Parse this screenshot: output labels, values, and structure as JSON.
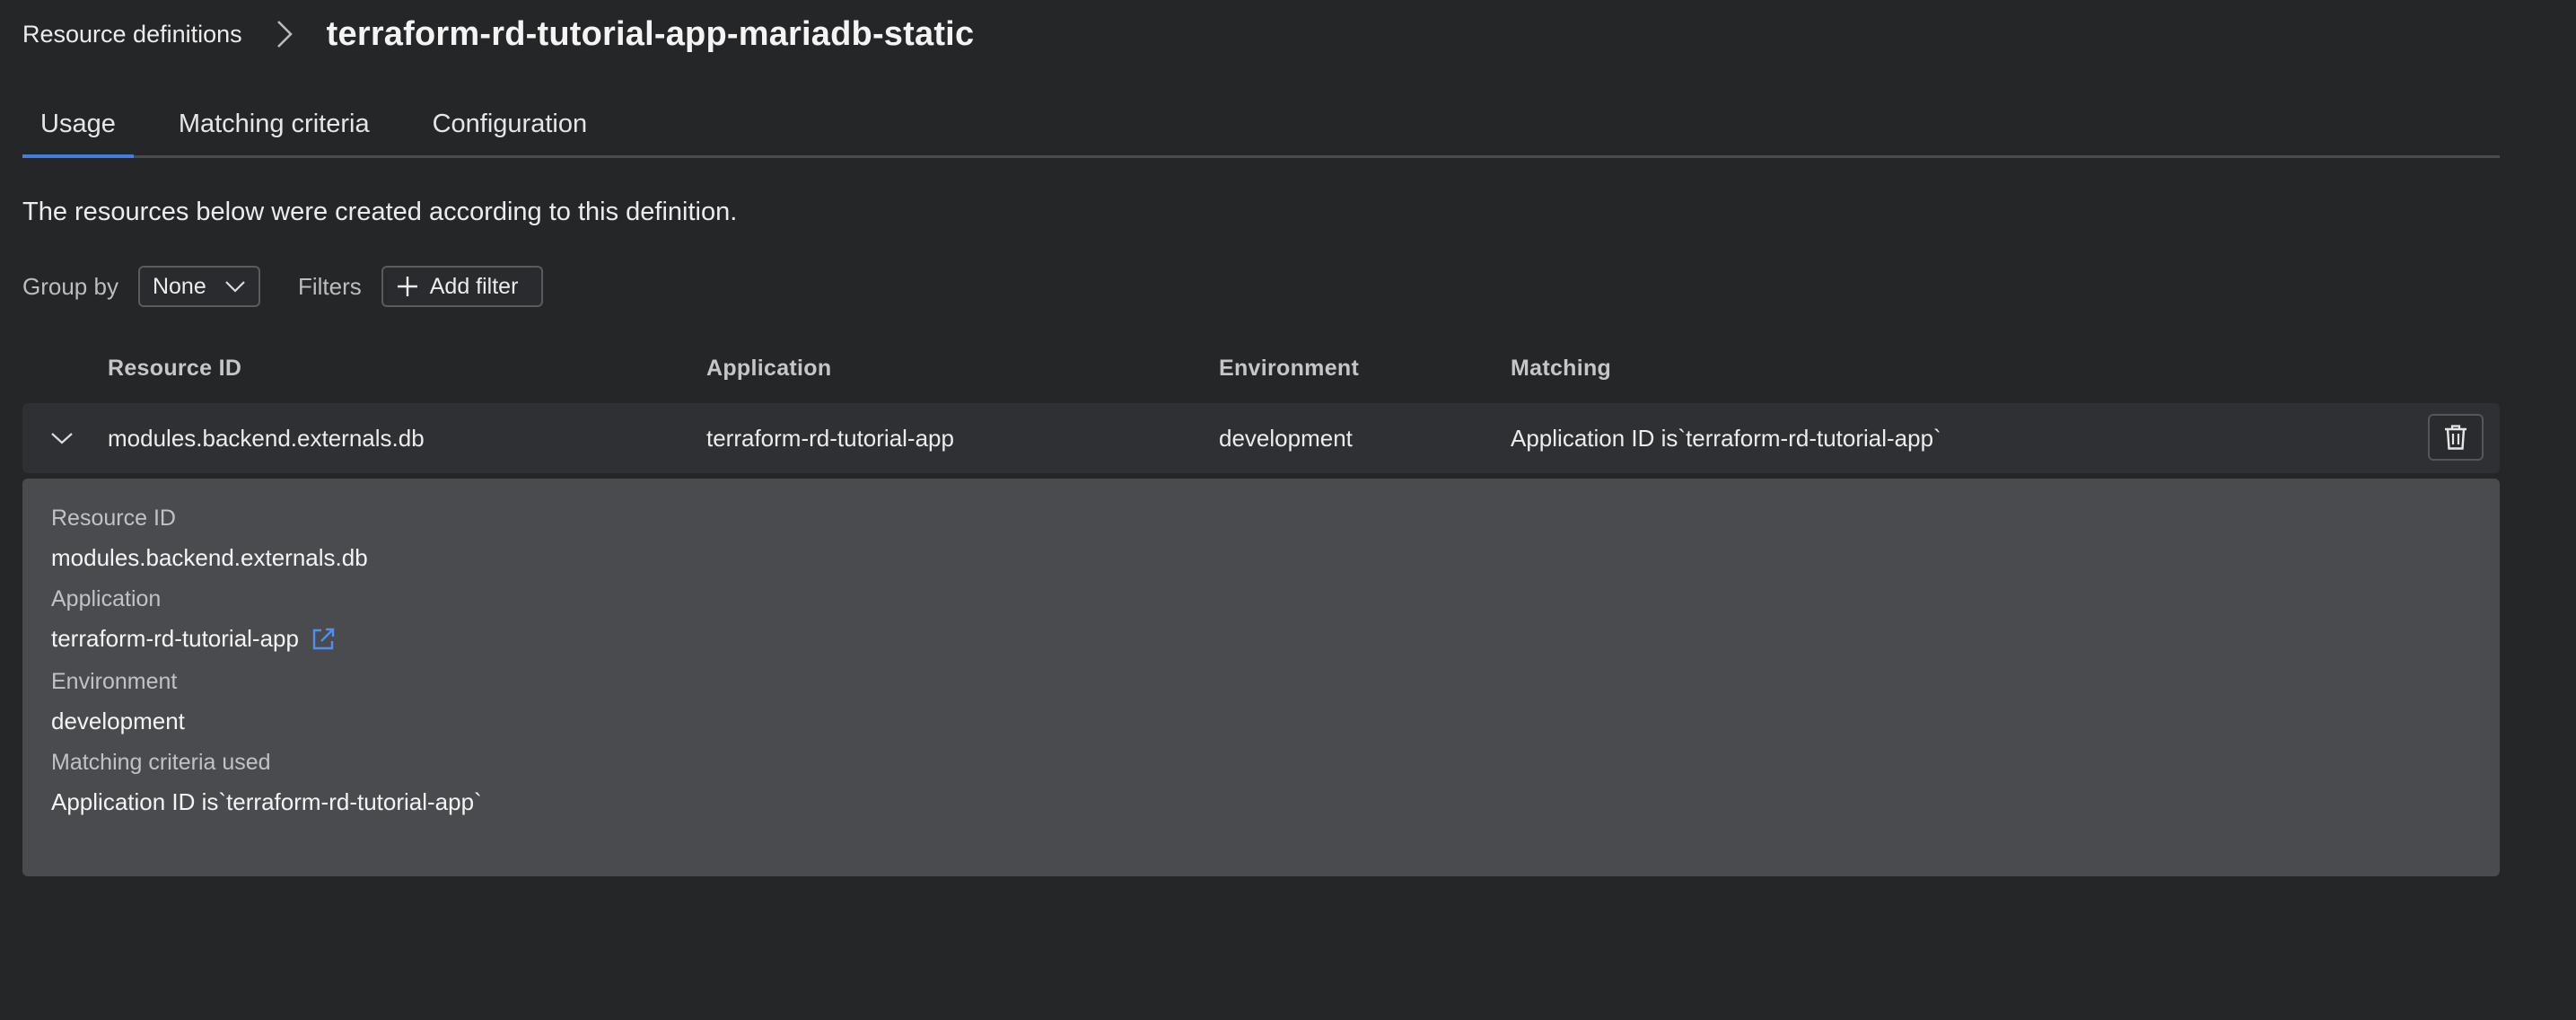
{
  "breadcrumb": {
    "parent": "Resource definitions",
    "current": "terraform-rd-tutorial-app-mariadb-static"
  },
  "tabs": [
    {
      "label": "Usage",
      "active": true
    },
    {
      "label": "Matching criteria",
      "active": false
    },
    {
      "label": "Configuration",
      "active": false
    }
  ],
  "description": "The resources below were created according to this definition.",
  "toolbar": {
    "group_by_label": "Group by",
    "group_by_value": "None",
    "filters_label": "Filters",
    "add_filter_label": "Add filter"
  },
  "table": {
    "columns": [
      "Resource ID",
      "Application",
      "Environment",
      "Matching"
    ],
    "rows": [
      {
        "resource_id": "modules.backend.externals.db",
        "application": "terraform-rd-tutorial-app",
        "environment": "development",
        "matching": "Application ID is`terraform-rd-tutorial-app`"
      }
    ]
  },
  "detail": {
    "resource_id_label": "Resource ID",
    "resource_id_value": "modules.backend.externals.db",
    "application_label": "Application",
    "application_value": "terraform-rd-tutorial-app",
    "environment_label": "Environment",
    "environment_value": "development",
    "matching_label": "Matching criteria used",
    "matching_value": "Application ID is`terraform-rd-tutorial-app`"
  },
  "colors": {
    "background": "#252628",
    "accent": "#3f7fe0",
    "row_background": "#2f3033",
    "detail_background": "#4a4b4f"
  },
  "icons": {
    "breadcrumb_separator": "chevron-right-icon",
    "select_caret": "chevron-down-icon",
    "add_filter": "plus-icon",
    "row_expand": "chevron-down-icon",
    "row_delete": "trash-icon",
    "external_link": "external-link-icon"
  }
}
